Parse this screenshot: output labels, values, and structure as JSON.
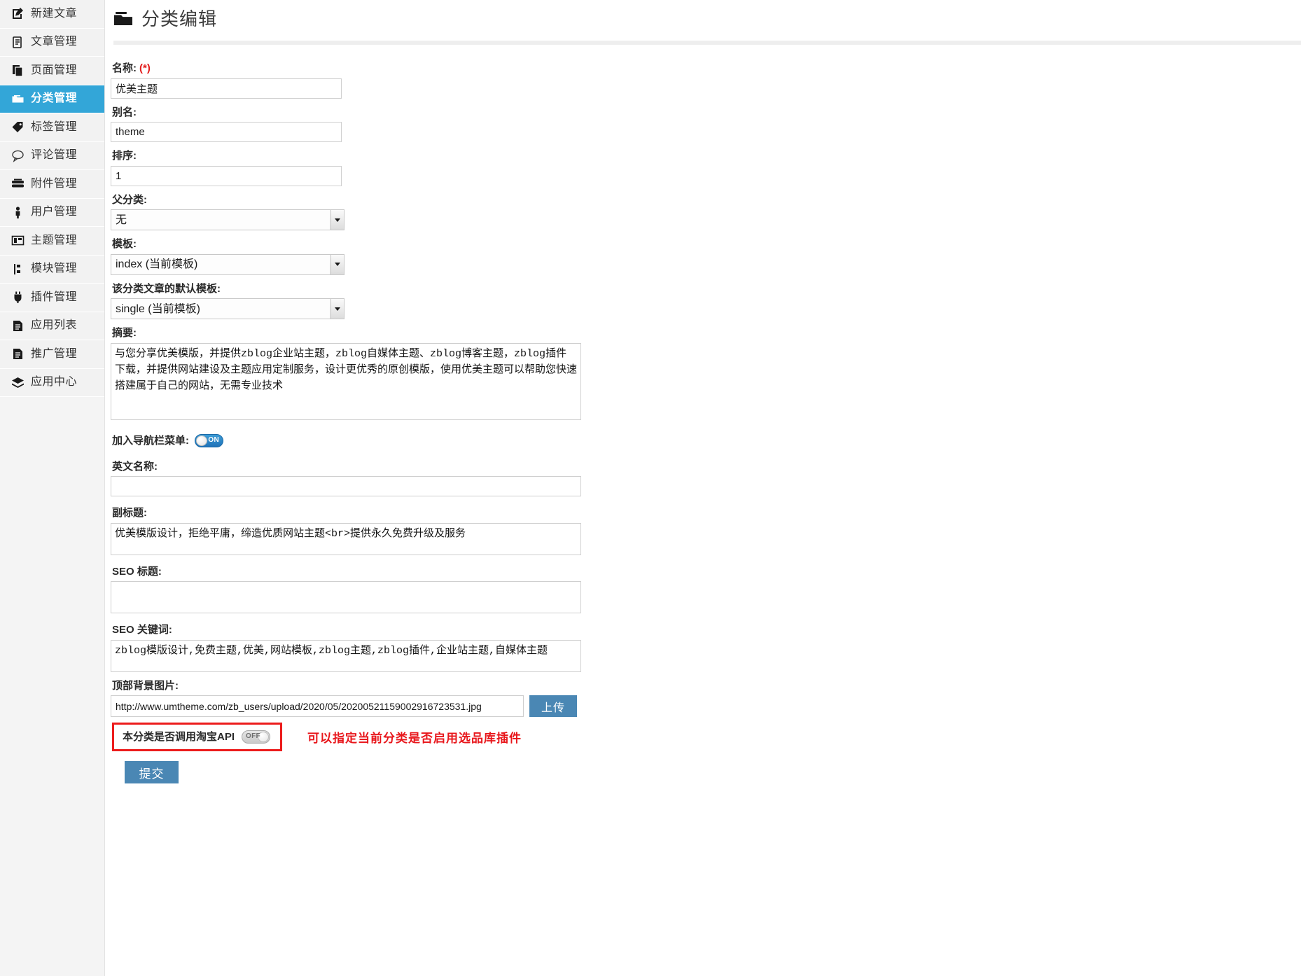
{
  "sidebar": {
    "items": [
      {
        "label": "新建文章",
        "icon": "new-article-icon",
        "active": false
      },
      {
        "label": "文章管理",
        "icon": "article-manage-icon",
        "active": false
      },
      {
        "label": "页面管理",
        "icon": "page-manage-icon",
        "active": false
      },
      {
        "label": "分类管理",
        "icon": "category-manage-icon",
        "active": true
      },
      {
        "label": "标签管理",
        "icon": "tag-icon",
        "active": false
      },
      {
        "label": "评论管理",
        "icon": "comment-icon",
        "active": false
      },
      {
        "label": "附件管理",
        "icon": "attachment-icon",
        "active": false
      },
      {
        "label": "用户管理",
        "icon": "user-icon",
        "active": false
      },
      {
        "label": "主题管理",
        "icon": "theme-icon",
        "active": false
      },
      {
        "label": "模块管理",
        "icon": "module-icon",
        "active": false
      },
      {
        "label": "插件管理",
        "icon": "plugin-icon",
        "active": false
      },
      {
        "label": "应用列表",
        "icon": "app-list-icon",
        "active": false
      },
      {
        "label": "推广管理",
        "icon": "promotion-icon",
        "active": false
      },
      {
        "label": "应用中心",
        "icon": "app-center-icon",
        "active": false
      }
    ]
  },
  "header": {
    "title": "分类编辑",
    "icon": "folder-icon"
  },
  "form": {
    "name": {
      "label": "名称:",
      "required_mark": "(*)",
      "value": "优美主题"
    },
    "alias": {
      "label": "别名:",
      "value": "theme"
    },
    "order": {
      "label": "排序:",
      "value": "1"
    },
    "parent_category": {
      "label": "父分类:",
      "value": "无",
      "options": [
        "无"
      ]
    },
    "template": {
      "label": "模板:",
      "value": "index (当前模板)",
      "options": [
        "index (当前模板)"
      ]
    },
    "default_article_template": {
      "label": "该分类文章的默认模板:",
      "value": "single (当前模板)",
      "options": [
        "single (当前模板)"
      ]
    },
    "summary": {
      "label": "摘要:",
      "value": "与您分享优美模版，并提供zblog企业站主题，zblog自媒体主题、zblog博客主题，zblog插件下载，并提供网站建设及主题应用定制服务，设计更优秀的原创模版，使用优美主题可以帮助您快速搭建属于自己的网站，无需专业技术"
    },
    "nav_menu": {
      "label": "加入导航栏菜单:",
      "state": "ON"
    },
    "english_name": {
      "label": "英文名称:",
      "value": ""
    },
    "subtitle": {
      "label": "副标题:",
      "value": "优美模版设计，拒绝平庸，缔造优质网站主题<br>提供永久免费升级及服务"
    },
    "seo_title": {
      "label": "SEO 标题:",
      "value": ""
    },
    "seo_keywords": {
      "label": "SEO 关键词:",
      "value": "zblog模版设计,免费主题,优美,网站模板,zblog主题,zblog插件,企业站主题,自媒体主题"
    },
    "top_background_image": {
      "label": "顶部背景图片:",
      "value": "http://www.umtheme.com/zb_users/upload/2020/05/20200521159002916723531.jpg",
      "upload_button": "上传"
    },
    "taobao_api": {
      "label": "本分类是否调用淘宝API",
      "state": "OFF"
    },
    "annotation": "可以指定当前分类是否启用选品库插件",
    "submit_button": "提交"
  },
  "colors": {
    "accent": "#33a6d8",
    "button": "#4a87b4",
    "required": "#e31b1b",
    "annotation": "#e8161b",
    "highlight_border": "#ec1c1c"
  }
}
